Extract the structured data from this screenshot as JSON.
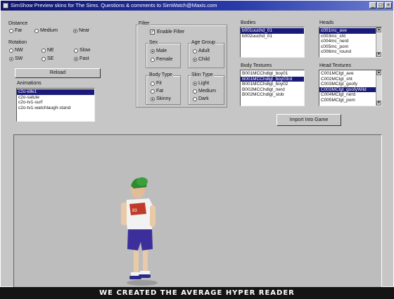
{
  "window": {
    "title": "SimShow  Preview skins for The Sims.  Questions & comments to SimWatch@Maxis.com",
    "minimize": "_",
    "maximize": "□",
    "close": "×"
  },
  "distance": {
    "label": "Distance",
    "options": [
      "Far",
      "Medium",
      "Near"
    ],
    "selected": "Near"
  },
  "rotation": {
    "label": "Rotation",
    "options": [
      "NW",
      "NE",
      "SW",
      "SE"
    ],
    "speeds": [
      "Slow",
      "Fast"
    ],
    "selected": "SW",
    "speed_selected": "Fast"
  },
  "reload_label": "Reload",
  "animations": {
    "label": "Animations",
    "items": [
      "c2o-idle1",
      "c2o-salute",
      "c2o-tv1-surf",
      "c2o-tv1-watchlaugh-stand"
    ],
    "selected_index": 0
  },
  "filter": {
    "label": "Filter",
    "enable_label": "Enable Filter",
    "enabled": true,
    "check_mark": "✓",
    "sex": {
      "label": "Sex",
      "options": [
        "Male",
        "Female"
      ],
      "selected": "Male"
    },
    "age": {
      "label": "Age Group",
      "options": [
        "Adult",
        "Child"
      ],
      "selected": "Child"
    },
    "body": {
      "label": "Body Type",
      "options": [
        "Fit",
        "Fat",
        "Skinny"
      ],
      "selected": "Skinny"
    },
    "skin": {
      "label": "Skin Type",
      "options": [
        "Light",
        "Medium",
        "Dark"
      ],
      "selected": "Light"
    }
  },
  "bodies": {
    "label": "Bodies",
    "items": [
      "b001uuchd_01",
      "b002uuchd_01"
    ],
    "selected_index": 0
  },
  "heads": {
    "label": "Heads",
    "items": [
      "c001mc_ave",
      "c003mc_sht",
      "c004mc_nerd",
      "c005mc_porn",
      "c006mc_round"
    ],
    "selected_index": 0
  },
  "body_textures": {
    "label": "Body Textures",
    "items": [
      "B001MCChdlgt_boy01",
      "B001MCChdlgt_boy03rd",
      "B001MCChdlgt_boy02",
      "B002MCChdlgt_nerd",
      "B002MCChdlgt_slob"
    ],
    "selected_index": 1
  },
  "head_textures": {
    "label": "Head Textures",
    "items": [
      "C001MClgt_ave",
      "C002MClgt_sht",
      "C003MClgt_goofy",
      "C003MClgt_goofyWild",
      "C004MClgt_nerd",
      "C005MClgt_pom"
    ],
    "selected_index": 3
  },
  "import_label": "Import Into Game",
  "banner_text": "WE CREATED THE AVERAGE HYPER READER",
  "icons": {
    "scroll_up": "▲",
    "scroll_down": "▼"
  }
}
